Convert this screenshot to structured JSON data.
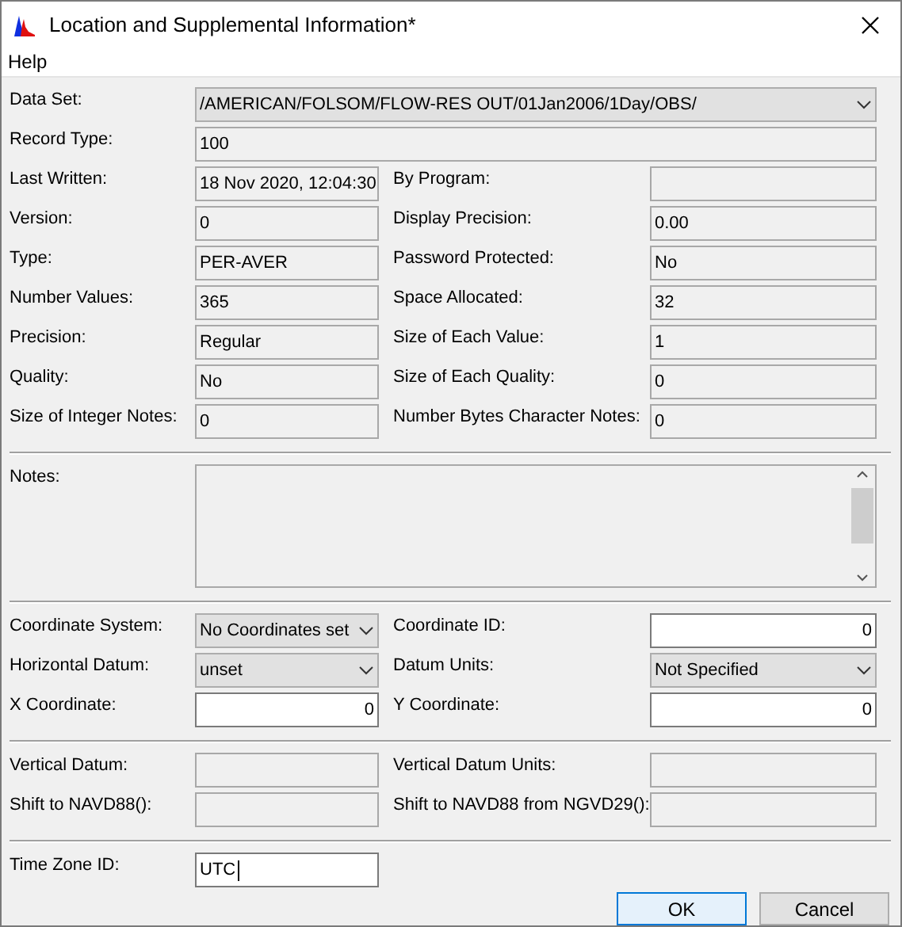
{
  "window": {
    "title": "Location and Supplemental Information*"
  },
  "menu": [
    {
      "label": "Help"
    }
  ],
  "sections": [
    {
      "rows": [
        {
          "fields": [
            {
              "label": "Data Set:",
              "value": "/AMERICAN/FOLSOM/FLOW-RES OUT/01Jan2006/1Day/OBS/",
              "kind": "combo",
              "wide": true
            }
          ]
        },
        {
          "fields": [
            {
              "label": "Record Type:",
              "value": "100",
              "kind": "readonly",
              "wide": true
            }
          ]
        },
        {
          "fields": [
            {
              "label": "Last Written:",
              "value": "18 Nov 2020, 12:04:30",
              "kind": "readonly"
            },
            {
              "label": "By Program:",
              "kind": "readonly"
            }
          ]
        },
        {
          "fields": [
            {
              "label": "Version:",
              "value": "0",
              "kind": "readonly"
            },
            {
              "label": "Display Precision:",
              "value": "0.00",
              "kind": "readonly"
            }
          ]
        },
        {
          "fields": [
            {
              "label": "Type:",
              "value": "PER-AVER",
              "kind": "readonly"
            },
            {
              "label": "Password Protected:",
              "value": "No",
              "kind": "readonly"
            }
          ]
        },
        {
          "fields": [
            {
              "label": "Number Values:",
              "value": "365",
              "kind": "readonly"
            },
            {
              "label": "Space Allocated:",
              "value": "32",
              "kind": "readonly"
            }
          ]
        },
        {
          "fields": [
            {
              "label": "Precision:",
              "value": "Regular",
              "kind": "readonly"
            },
            {
              "label": "Size of Each Value:",
              "value": "1",
              "kind": "readonly"
            }
          ]
        },
        {
          "fields": [
            {
              "label": "Quality:",
              "value": "No",
              "kind": "readonly"
            },
            {
              "label": "Size of Each Quality:",
              "value": "0",
              "kind": "readonly"
            }
          ]
        },
        {
          "fields": [
            {
              "label": "Size of Integer Notes:",
              "value": "0",
              "kind": "readonly"
            },
            {
              "label": "Number Bytes Character Notes:",
              "value": "0",
              "kind": "readonly"
            }
          ]
        }
      ]
    },
    {
      "rows": [
        {
          "fields": [
            {
              "label": "Notes:",
              "kind": "notes",
              "wide": true
            }
          ]
        }
      ]
    },
    {
      "rows": [
        {
          "fields": [
            {
              "label": "Coordinate System:",
              "value": "No Coordinates set",
              "kind": "combo"
            },
            {
              "label": "Coordinate ID:",
              "value": "0",
              "kind": "number"
            }
          ]
        },
        {
          "fields": [
            {
              "label": "Horizontal Datum:",
              "value": "unset",
              "kind": "combo"
            },
            {
              "label": "Datum Units:",
              "value": "Not Specified",
              "kind": "combo"
            }
          ]
        },
        {
          "fields": [
            {
              "label": "X Coordinate:",
              "value": "0",
              "kind": "number"
            },
            {
              "label": "Y Coordinate:",
              "value": "0",
              "kind": "number"
            }
          ]
        }
      ]
    },
    {
      "rows": [
        {
          "fields": [
            {
              "label": "Vertical Datum:",
              "kind": "readonly"
            },
            {
              "label": "Vertical Datum Units:",
              "kind": "readonly"
            }
          ]
        },
        {
          "fields": [
            {
              "label": "Shift to NAVD88():",
              "kind": "readonly"
            },
            {
              "label": "Shift to NAVD88 from NGVD29():",
              "kind": "readonly"
            }
          ]
        }
      ]
    },
    {
      "rows": [
        {
          "fields": [
            {
              "label": "Time Zone ID:",
              "value": "UTC",
              "kind": "input"
            }
          ]
        }
      ]
    }
  ],
  "buttons": [
    {
      "label": "OK",
      "selected": true
    },
    {
      "label": "Cancel",
      "selected": false
    }
  ]
}
